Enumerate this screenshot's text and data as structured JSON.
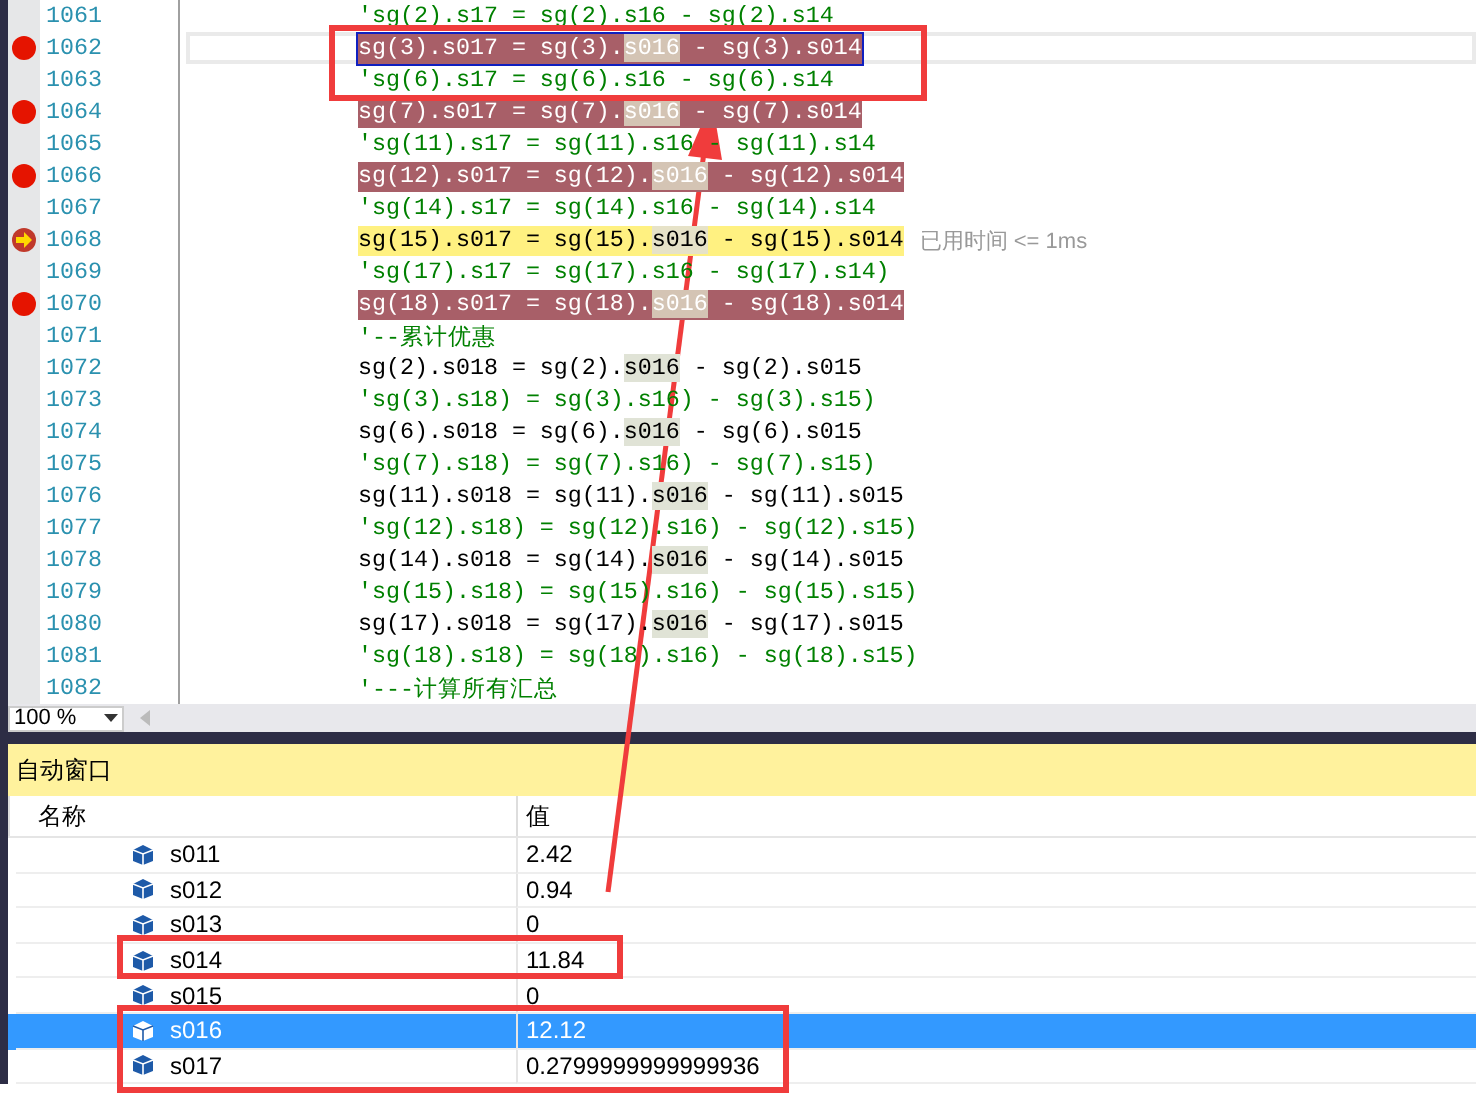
{
  "editor": {
    "lines": [
      {
        "number": "1061",
        "breakpoint": false,
        "current": false,
        "kind": "comment",
        "selected": false,
        "segments": [
          {
            "text": "'sg(2).s17 = sg(2).s16 - sg(2).s14",
            "highlight": false
          }
        ]
      },
      {
        "number": "1062",
        "breakpoint": true,
        "current": false,
        "kind": "code",
        "selected": true,
        "segments": [
          {
            "text": "sg(3).s017 = sg(3).",
            "highlight": false
          },
          {
            "text": "s016",
            "highlight": true
          },
          {
            "text": " - sg(3).s014",
            "highlight": false
          }
        ]
      },
      {
        "number": "1063",
        "breakpoint": false,
        "current": false,
        "kind": "comment",
        "selected": false,
        "segments": [
          {
            "text": "'sg(6).s17 = sg(6).s16 - sg(6).s14",
            "highlight": false
          }
        ]
      },
      {
        "number": "1064",
        "breakpoint": true,
        "current": false,
        "kind": "code",
        "selected": false,
        "segments": [
          {
            "text": "sg(7).s017 = sg(7).",
            "highlight": false
          },
          {
            "text": "s016",
            "highlight": true
          },
          {
            "text": " - sg(7).s014",
            "highlight": false
          }
        ]
      },
      {
        "number": "1065",
        "breakpoint": false,
        "current": false,
        "kind": "comment",
        "selected": false,
        "segments": [
          {
            "text": "'sg(11).s17 = sg(11).s16 - sg(11).s14",
            "highlight": false
          }
        ]
      },
      {
        "number": "1066",
        "breakpoint": true,
        "current": false,
        "kind": "code",
        "selected": false,
        "segments": [
          {
            "text": "sg(12).s017 = sg(12).",
            "highlight": false
          },
          {
            "text": "s016",
            "highlight": true
          },
          {
            "text": " - sg(12).s014",
            "highlight": false
          }
        ]
      },
      {
        "number": "1067",
        "breakpoint": false,
        "current": false,
        "kind": "comment",
        "selected": false,
        "segments": [
          {
            "text": "'sg(14).s17 = sg(14).s16 - sg(14).s14",
            "highlight": false
          }
        ]
      },
      {
        "number": "1068",
        "breakpoint": false,
        "current": true,
        "kind": "code",
        "selected": false,
        "timing": "已用时间 <= 1ms",
        "segments": [
          {
            "text": "sg(15).s017 = sg(15).",
            "highlight": false
          },
          {
            "text": "s016",
            "highlight": true
          },
          {
            "text": " - sg(15).s014",
            "highlight": false
          }
        ]
      },
      {
        "number": "1069",
        "breakpoint": false,
        "current": false,
        "kind": "comment",
        "selected": false,
        "segments": [
          {
            "text": "'sg(17).s17 = sg(17).s16 - sg(17).s14)",
            "highlight": false
          }
        ]
      },
      {
        "number": "1070",
        "breakpoint": true,
        "current": false,
        "kind": "code",
        "selected": false,
        "segments": [
          {
            "text": "sg(18).s017 = sg(18).",
            "highlight": false
          },
          {
            "text": "s016",
            "highlight": true
          },
          {
            "text": " - sg(18).s014",
            "highlight": false
          }
        ]
      },
      {
        "number": "1071",
        "breakpoint": false,
        "current": false,
        "kind": "comment",
        "selected": false,
        "segments": [
          {
            "text": "'--累计优惠",
            "highlight": false
          }
        ]
      },
      {
        "number": "1072",
        "breakpoint": false,
        "current": false,
        "kind": "code",
        "selected": false,
        "segments": [
          {
            "text": "sg(2).s018 = sg(2).",
            "highlight": false
          },
          {
            "text": "s016",
            "highlight": true
          },
          {
            "text": " - sg(2).s015",
            "highlight": false
          }
        ]
      },
      {
        "number": "1073",
        "breakpoint": false,
        "current": false,
        "kind": "comment",
        "selected": false,
        "segments": [
          {
            "text": "'sg(3).s18) = sg(3).s16) - sg(3).s15)",
            "highlight": false
          }
        ]
      },
      {
        "number": "1074",
        "breakpoint": false,
        "current": false,
        "kind": "code",
        "selected": false,
        "segments": [
          {
            "text": "sg(6).s018 = sg(6).",
            "highlight": false
          },
          {
            "text": "s016",
            "highlight": true
          },
          {
            "text": " - sg(6).s015",
            "highlight": false
          }
        ]
      },
      {
        "number": "1075",
        "breakpoint": false,
        "current": false,
        "kind": "comment",
        "selected": false,
        "segments": [
          {
            "text": "'sg(7).s18) = sg(7).s16) - sg(7).s15)",
            "highlight": false
          }
        ]
      },
      {
        "number": "1076",
        "breakpoint": false,
        "current": false,
        "kind": "code",
        "selected": false,
        "segments": [
          {
            "text": "sg(11).s018 = sg(11).",
            "highlight": false
          },
          {
            "text": "s016",
            "highlight": true
          },
          {
            "text": " - sg(11).s015",
            "highlight": false
          }
        ]
      },
      {
        "number": "1077",
        "breakpoint": false,
        "current": false,
        "kind": "comment",
        "selected": false,
        "segments": [
          {
            "text": "'sg(12).s18) = sg(12).s16) - sg(12).s15)",
            "highlight": false
          }
        ]
      },
      {
        "number": "1078",
        "breakpoint": false,
        "current": false,
        "kind": "code",
        "selected": false,
        "segments": [
          {
            "text": "sg(14).s018 = sg(14).",
            "highlight": false
          },
          {
            "text": "s016",
            "highlight": true
          },
          {
            "text": " - sg(14).s015",
            "highlight": false
          }
        ]
      },
      {
        "number": "1079",
        "breakpoint": false,
        "current": false,
        "kind": "comment",
        "selected": false,
        "segments": [
          {
            "text": "'sg(15).s18) = sg(15).s16) - sg(15).s15)",
            "highlight": false
          }
        ]
      },
      {
        "number": "1080",
        "breakpoint": false,
        "current": false,
        "kind": "code",
        "selected": false,
        "segments": [
          {
            "text": "sg(17).s018 = sg(17).",
            "highlight": false
          },
          {
            "text": "s016",
            "highlight": true
          },
          {
            "text": " - sg(17).s015",
            "highlight": false
          }
        ]
      },
      {
        "number": "1081",
        "breakpoint": false,
        "current": false,
        "kind": "comment",
        "selected": false,
        "segments": [
          {
            "text": "'sg(18).s18) = sg(18).s16) - sg(18).s15)",
            "highlight": false
          }
        ]
      },
      {
        "number": "1082",
        "breakpoint": false,
        "current": false,
        "kind": "comment",
        "selected": false,
        "segments": [
          {
            "text": "'---计算所有汇总",
            "highlight": false
          }
        ]
      }
    ],
    "zoom": "100 %"
  },
  "autos": {
    "title": "自动窗口",
    "columns": [
      "名称",
      "值"
    ],
    "rows": [
      {
        "name": "s011",
        "value": "2.42",
        "selected": false
      },
      {
        "name": "s012",
        "value": "0.94",
        "selected": false
      },
      {
        "name": "s013",
        "value": "0",
        "selected": false
      },
      {
        "name": "s014",
        "value": "11.84",
        "selected": false
      },
      {
        "name": "s015",
        "value": "0",
        "selected": false
      },
      {
        "name": "s016",
        "value": "12.12",
        "selected": true
      },
      {
        "name": "s017",
        "value": "0.2799999999999936",
        "selected": false
      }
    ]
  }
}
